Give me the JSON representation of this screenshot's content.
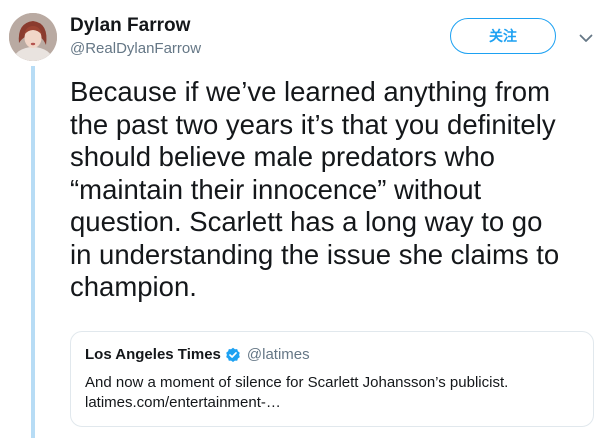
{
  "colors": {
    "accent": "#1da1f2",
    "thread_line": "#b7dcf5",
    "secondary_text": "#657786",
    "primary_text": "#14171a",
    "verified": "#1da1f2"
  },
  "author": {
    "display_name": "Dylan Farrow",
    "handle": "@RealDylanFarrow",
    "avatar_icon": "user-avatar"
  },
  "actions": {
    "follow_label": "关注",
    "more_icon": "chevron-down-icon"
  },
  "tweet": {
    "text_lines": [
      "Because if we’ve learned anything from",
      "the past two years it’s that you definitely",
      "should believe male predators who",
      "“maintain their innocence” without",
      "question. Scarlett has a long way to go",
      "in understanding the issue she claims to",
      "champion."
    ]
  },
  "quoted_tweet": {
    "display_name": "Los Angeles Times",
    "verified_icon": "verified-badge-icon",
    "handle": "@latimes",
    "text_lines": [
      "And now a moment of silence for Scarlett Johansson’s publicist.",
      "latimes.com/entertainment-…"
    ]
  }
}
